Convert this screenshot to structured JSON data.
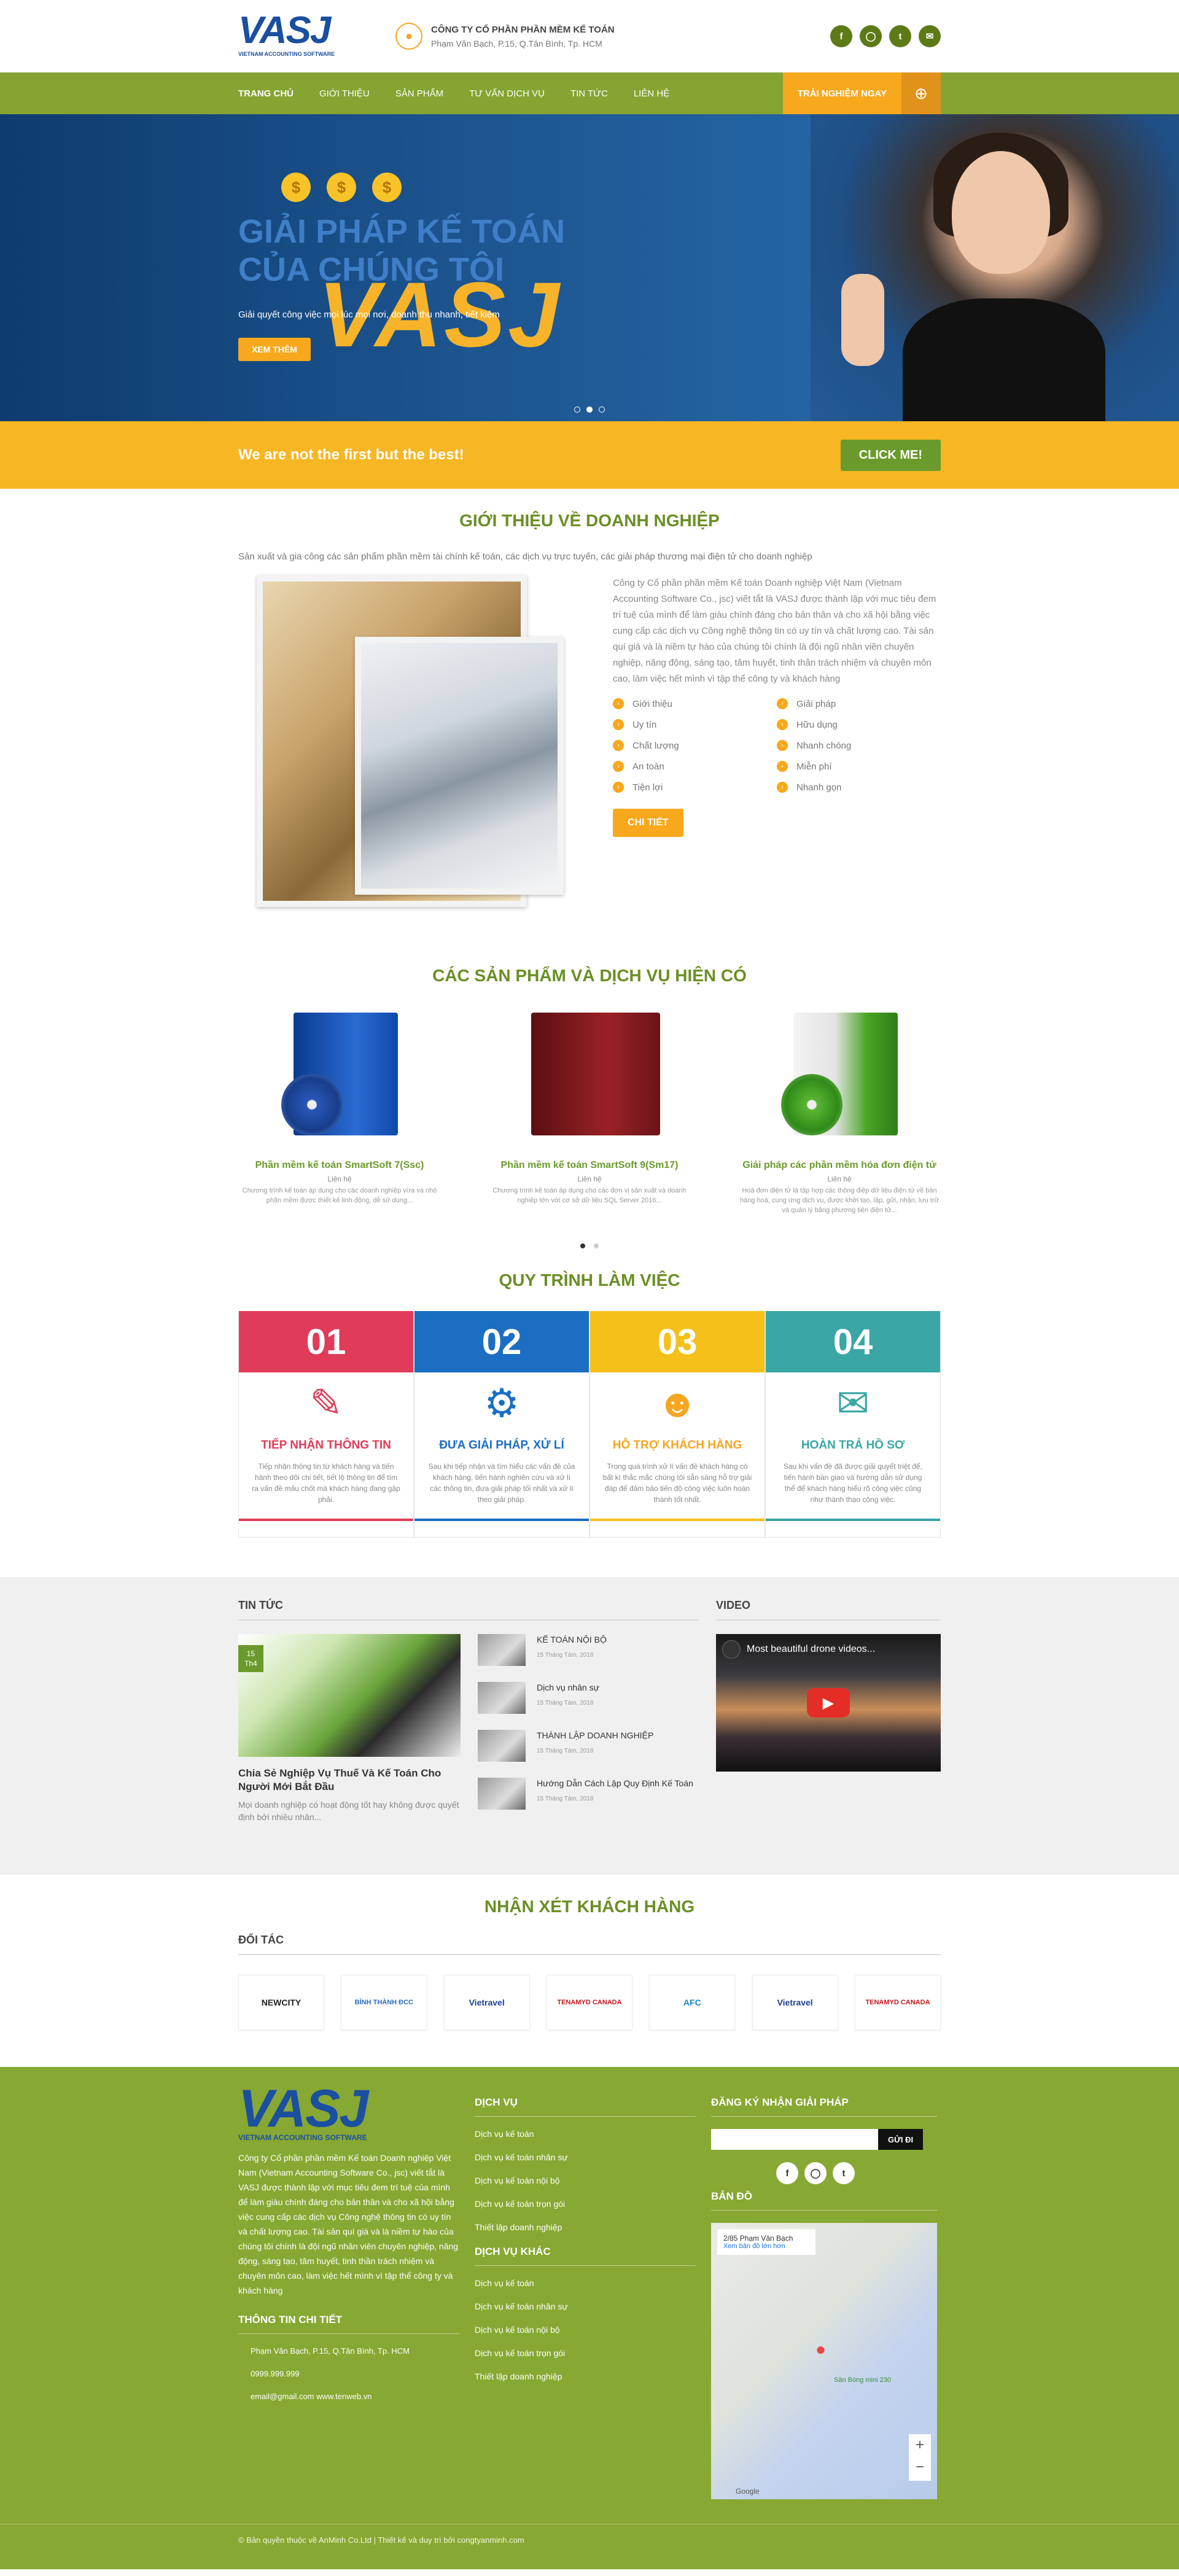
{
  "header": {
    "logo_main": "VASJ",
    "logo_sub": "VIETNAM ACCOUNTING SOFTWARE",
    "company": "CÔNG TY CỔ PHẦN PHẦN MỀM KẾ TOÁN",
    "address": "Phạm Văn Bạch, P.15, Q.Tân Bình, Tp. HCM",
    "socials": [
      "facebook-icon",
      "instagram-icon",
      "twitter-icon",
      "mail-icon"
    ]
  },
  "nav": {
    "items": [
      "TRANG CHỦ",
      "GIỚI THIỆU",
      "SẢN PHẨM",
      "TƯ VẤN DỊCH VỤ",
      "TIN TỨC",
      "LIÊN HỆ"
    ],
    "cta": "TRẢI NGHIỆM NGAY"
  },
  "hero": {
    "title": "GIẢI PHÁP KẾ TOÁN CỦA CHÚNG TÔI",
    "brand": "VASJ",
    "subtitle": "Giải quyết công việc mọi lúc mọi nơi, doanh thu nhanh, tiết kiệm",
    "button": "XEM THÊM"
  },
  "banner": {
    "text": "We are not the first but the best!",
    "button": "CLICK ME!"
  },
  "intro": {
    "title": "GIỚI THIỆU VỀ DOANH NGHIỆP",
    "lead": "Sản xuất và gia công các sản phẩm phần mềm tài chính kế toán, các dịch vụ trực tuyến, các giải pháp thương mại điện tử cho doanh nghiệp",
    "body": "Công ty Cổ phần phần mềm Kế toán Doanh nghiệp Việt Nam (Vietnam Accounting Software Co., jsc) viết tắt là VASJ được thành lập với mục tiêu đem trí tuệ của mình để làm giàu chính đáng cho bản thân và cho xã hội bằng việc cung cấp các dịch vụ Công nghệ thông tin có uy tín và chất lượng cao. Tài sản quí giá và là niềm tự hào của chúng tôi chính là đội ngũ nhân viên chuyên nghiệp, năng động, sáng tạo, tâm huyết, tinh thần trách nhiệm và chuyên môn cao, làm việc hết mình vì tập thể công ty và khách hàng",
    "features": [
      "Giới thiệu",
      "Giải pháp",
      "Uy tín",
      "Hữu dụng",
      "Chất lượng",
      "Nhanh chóng",
      "An toàn",
      "Miễn phí",
      "Tiện lợi",
      "Nhanh gọn"
    ],
    "button": "CHI TIẾT"
  },
  "products": {
    "title": "CÁC SẢN PHẨM VÀ DỊCH VỤ HIỆN CÓ",
    "items": [
      {
        "name": "Phần mềm kế toán SmartSoft 7(Ssc)",
        "price": "Liên hệ",
        "desc": "Chương trình kế toán áp dụng cho các doanh nghiệp vừa và nhỏ phần mềm được thiết kế linh động, dễ sử dụng..."
      },
      {
        "name": "Phần mềm kế toán SmartSoft 9(Sm17)",
        "price": "Liên hệ",
        "desc": "Chương trình kế toán áp dụng cho các đơn vị sản xuất và doanh nghiệp lớn với cơ sở dữ liệu SQL Server 2016..."
      },
      {
        "name": "Giải pháp các phần mềm hóa đơn điện tử",
        "price": "Liên hệ",
        "desc": "Hoá đơn điện tử là tập hợp các thông điệp dữ liệu điện tử về bán hàng hoá, cung ứng dịch vụ, được khởi tạo, lập, gửi, nhận, lưu trữ và quản lý bằng phương tiện điện tử..."
      }
    ]
  },
  "process": {
    "title": "QUY TRÌNH LÀM VIỆC",
    "steps": [
      {
        "num": "01",
        "title": "TIẾP NHẬN THÔNG TIN",
        "desc": "Tiếp nhận thông tin từ khách hàng và tiến hành theo dõi chi tiết, tiết lộ thông tin để tìm ra vấn đề mấu chốt mà khách hàng đang gặp phải.",
        "color": "#e03c5a"
      },
      {
        "num": "02",
        "title": "ĐƯA GIẢI PHÁP, XỬ LÍ",
        "desc": "Sau khi tiếp nhận và tìm hiểu các vấn đề của khách hàng, tiến hành nghiên cứu và xử lí các thông tin, đưa giải pháp tối nhất và xử lí theo giải pháp.",
        "color": "#1b6ec2"
      },
      {
        "num": "03",
        "title": "HỖ TRỢ KHÁCH HÀNG",
        "desc": "Trong quá trình xử lí vấn đề khách hàng có bất kì thắc mắc chúng tôi sẵn sàng hỗ trợ giải đáp để đảm bảo tiến độ công việc luôn hoàn thành tốt nhất.",
        "color": "#f5c019"
      },
      {
        "num": "04",
        "title": "HOÀN TRẢ HỒ SƠ",
        "desc": "Sau khi vấn đề đã được giải quyết triệt để, tiến hành bàn giao và hướng dẫn sử dụng thể để khách hàng hiểu rõ công việc cũng như thành thạo công việc.",
        "color": "#3aa7a5"
      }
    ]
  },
  "news": {
    "title": "TIN TỨC",
    "featured": {
      "day": "15",
      "month": "Th4",
      "title": "Chia Sẻ Nghiệp Vụ Thuế Và Kế Toán Cho Người Mới Bắt Đầu",
      "excerpt": "Mọi doanh nghiệp có hoạt động tốt hay không được quyết định bởi nhiều nhân..."
    },
    "items": [
      {
        "title": "KẾ TOÁN NỘI BỘ",
        "date": "15 Tháng Tám, 2018"
      },
      {
        "title": "Dịch vụ nhân sự",
        "date": "15 Tháng Tám, 2018"
      },
      {
        "title": "THÀNH LẬP DOANH NGHIỆP",
        "date": "15 Tháng Tám, 2018"
      },
      {
        "title": "Hướng Dẫn Cách Lập Quy Định Kế Toán",
        "date": "15 Tháng Tám, 2018"
      }
    ],
    "video_title": "VIDEO",
    "video_caption": "Most beautiful drone videos..."
  },
  "testimonials": {
    "title": "NHẬN XÉT KHÁCH HÀNG"
  },
  "partners": {
    "title": "ĐỐI TÁC",
    "logos": [
      "NEWCITY",
      "BÌNH THÀNH ĐCC",
      "Vietravel",
      "TENAMYD CANADA",
      "AFC",
      "Vietravel",
      "TENAMYD CANADA"
    ]
  },
  "footer": {
    "about": "Công ty Cổ phần phần mềm Kế toán Doanh nghiệp Việt Nam (Vietnam Accounting Software Co., jsc) viết tắt là VASJ được thành lập với mục tiêu đem trí tuệ của mình để làm giàu chính đáng cho bản thân và cho xã hội bằng việc cung cấp các dịch vụ Công nghệ thông tin có uy tín và chất lượng cao. Tài sản quí giá và là niềm tự hào của chúng tôi chính là đội ngũ nhân viên chuyên nghiệp, năng động, sáng tạo, tâm huyết, tinh thần trách nhiệm và chuyên môn cao, làm việc hết mình vì tập thể công ty và khách hàng",
    "contact_title": "THÔNG TIN CHI TIẾT",
    "contact": [
      "Phạm Văn Bạch, P.15, Q.Tân Bình, Tp. HCM",
      "0999.999.999",
      "email@gmail.com   www.tenweb.vn"
    ],
    "services_title": "DỊCH VỤ",
    "services": [
      "Dịch vụ kế toán",
      "Dịch vụ kế toán nhân sự",
      "Dịch vụ kế toán nội bộ",
      "Dịch vụ kế toán trọn gói",
      "Thiết lập doanh nghiệp"
    ],
    "other_title": "DỊCH VỤ KHÁC",
    "other": [
      "Dịch vụ kế toán",
      "Dịch vụ kế toán nhân sự",
      "Dịch vụ kế toán nội bộ",
      "Dịch vụ kế toán trọn gói",
      "Thiết lập doanh nghiệp"
    ],
    "subscribe_title": "ĐĂNG KÝ NHẬN GIẢI PHÁP",
    "subscribe_btn": "GỬI ĐI",
    "map_title": "BẢN ĐỒ",
    "map_card": "2/85 Phạm Văn Bạch",
    "map_link": "Xem bản đồ lớn hơn",
    "map_label": "Sân Bóng mini 230",
    "copyright": "© Bản quyền thuộc về AnMinh Co.Ltd  |  Thiết kế và duy trì bởi congtyanminh.com"
  }
}
